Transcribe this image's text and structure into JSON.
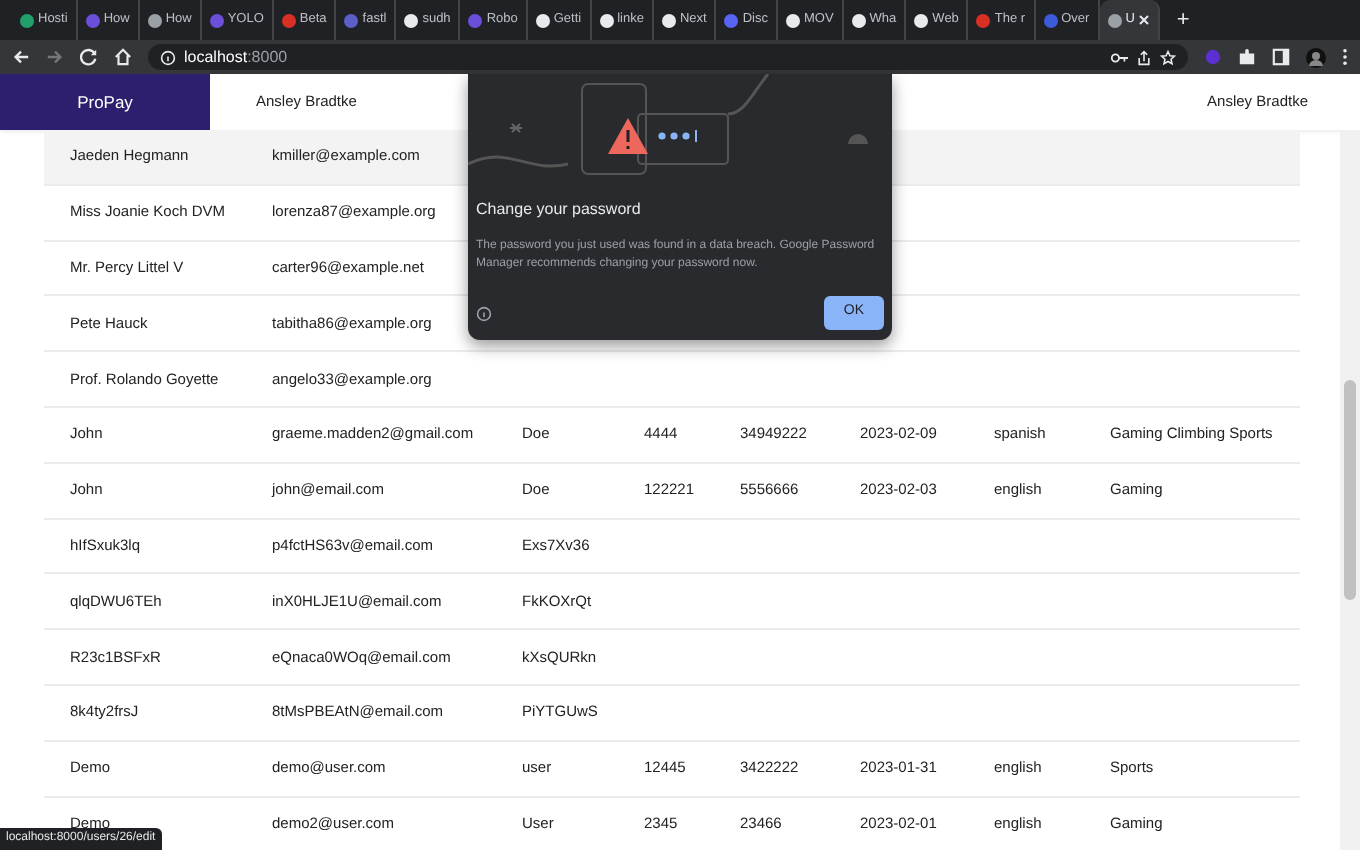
{
  "browser": {
    "tabs": [
      {
        "title": "Hosti",
        "color": "#22a06b",
        "selected": false
      },
      {
        "title": "How",
        "color": "#6b4fd8",
        "selected": false
      },
      {
        "title": "How",
        "color": "#9aa0a6",
        "selected": false
      },
      {
        "title": "YOLO",
        "color": "#6b4fd8",
        "selected": false
      },
      {
        "title": "Beta",
        "color": "#d93025",
        "selected": false
      },
      {
        "title": "fastl",
        "color": "#5b5fc7",
        "selected": false
      },
      {
        "title": "sudh",
        "color": "#e8eaed",
        "selected": false
      },
      {
        "title": "Robo",
        "color": "#6b4fd8",
        "selected": false
      },
      {
        "title": "Getti",
        "color": "#e8eaed",
        "selected": false
      },
      {
        "title": "linke",
        "color": "#e8eaed",
        "selected": false
      },
      {
        "title": "Next",
        "color": "#e8eaed",
        "selected": false
      },
      {
        "title": "Disc",
        "color": "#5865f2",
        "selected": false
      },
      {
        "title": "MOV",
        "color": "#e8eaed",
        "selected": false
      },
      {
        "title": "Wha",
        "color": "#e8eaed",
        "selected": false
      },
      {
        "title": "Web",
        "color": "#e8eaed",
        "selected": false
      },
      {
        "title": "The r",
        "color": "#d93025",
        "selected": false
      },
      {
        "title": "Over",
        "color": "#3b5bdb",
        "selected": false
      },
      {
        "title": "U",
        "color": "#9aa0a6",
        "selected": true
      }
    ],
    "new_tab": "+",
    "address": {
      "host": "localhost",
      "port": ":8000"
    }
  },
  "navbar": {
    "brand": "ProPay",
    "user_left": "Ansley Bradtke",
    "user_right": "Ansley Bradtke"
  },
  "table": {
    "rows": [
      {
        "highlighted": true,
        "cells": [
          "Jaeden Hegmann",
          "kmiller@example.com"
        ]
      },
      {
        "highlighted": false,
        "cells": [
          "Miss Joanie Koch DVM",
          "lorenza87@example.org"
        ]
      },
      {
        "highlighted": false,
        "cells": [
          "Mr. Percy Littel V",
          "carter96@example.net"
        ]
      },
      {
        "highlighted": false,
        "cells": [
          "Pete Hauck",
          "tabitha86@example.org"
        ]
      },
      {
        "highlighted": false,
        "cells": [
          "Prof. Rolando Goyette",
          "angelo33@example.org"
        ]
      },
      {
        "highlighted": false,
        "cells": [
          "John",
          "graeme.madden2@gmail.com",
          "Doe",
          "4444",
          "34949222",
          "2023-02-09",
          "spanish",
          "Gaming Climbing Sports"
        ]
      },
      {
        "highlighted": false,
        "cells": [
          "John",
          "john@email.com",
          "Doe",
          "122221",
          "5556666",
          "2023-02-03",
          "english",
          "Gaming"
        ]
      },
      {
        "highlighted": false,
        "cells": [
          "hIfSxuk3lq",
          "p4fctHS63v@email.com",
          "Exs7Xv36"
        ]
      },
      {
        "highlighted": false,
        "cells": [
          "qlqDWU6TEh",
          "inX0HLJE1U@email.com",
          "FkKOXrQt"
        ]
      },
      {
        "highlighted": false,
        "cells": [
          "R23c1BSFxR",
          "eQnaca0WOq@email.com",
          "kXsQURkn"
        ]
      },
      {
        "highlighted": false,
        "cells": [
          "8k4ty2frsJ",
          "8tMsPBEAtN@email.com",
          "PiYTGUwS"
        ]
      },
      {
        "highlighted": false,
        "cells": [
          "Demo",
          "demo@user.com",
          "user",
          "12445",
          "3422222",
          "2023-01-31",
          "english",
          "Sports"
        ]
      },
      {
        "highlighted": false,
        "cells": [
          "Demo",
          "demo2@user.com",
          "User",
          "2345",
          "23466",
          "2023-02-01",
          "english",
          "Gaming"
        ]
      }
    ]
  },
  "dialog": {
    "title": "Change your password",
    "body": "The password you just used was found in a data breach. Google Password Manager recommends changing your password now.",
    "button": "OK"
  },
  "status_url": "localhost:8000/users/26/edit"
}
